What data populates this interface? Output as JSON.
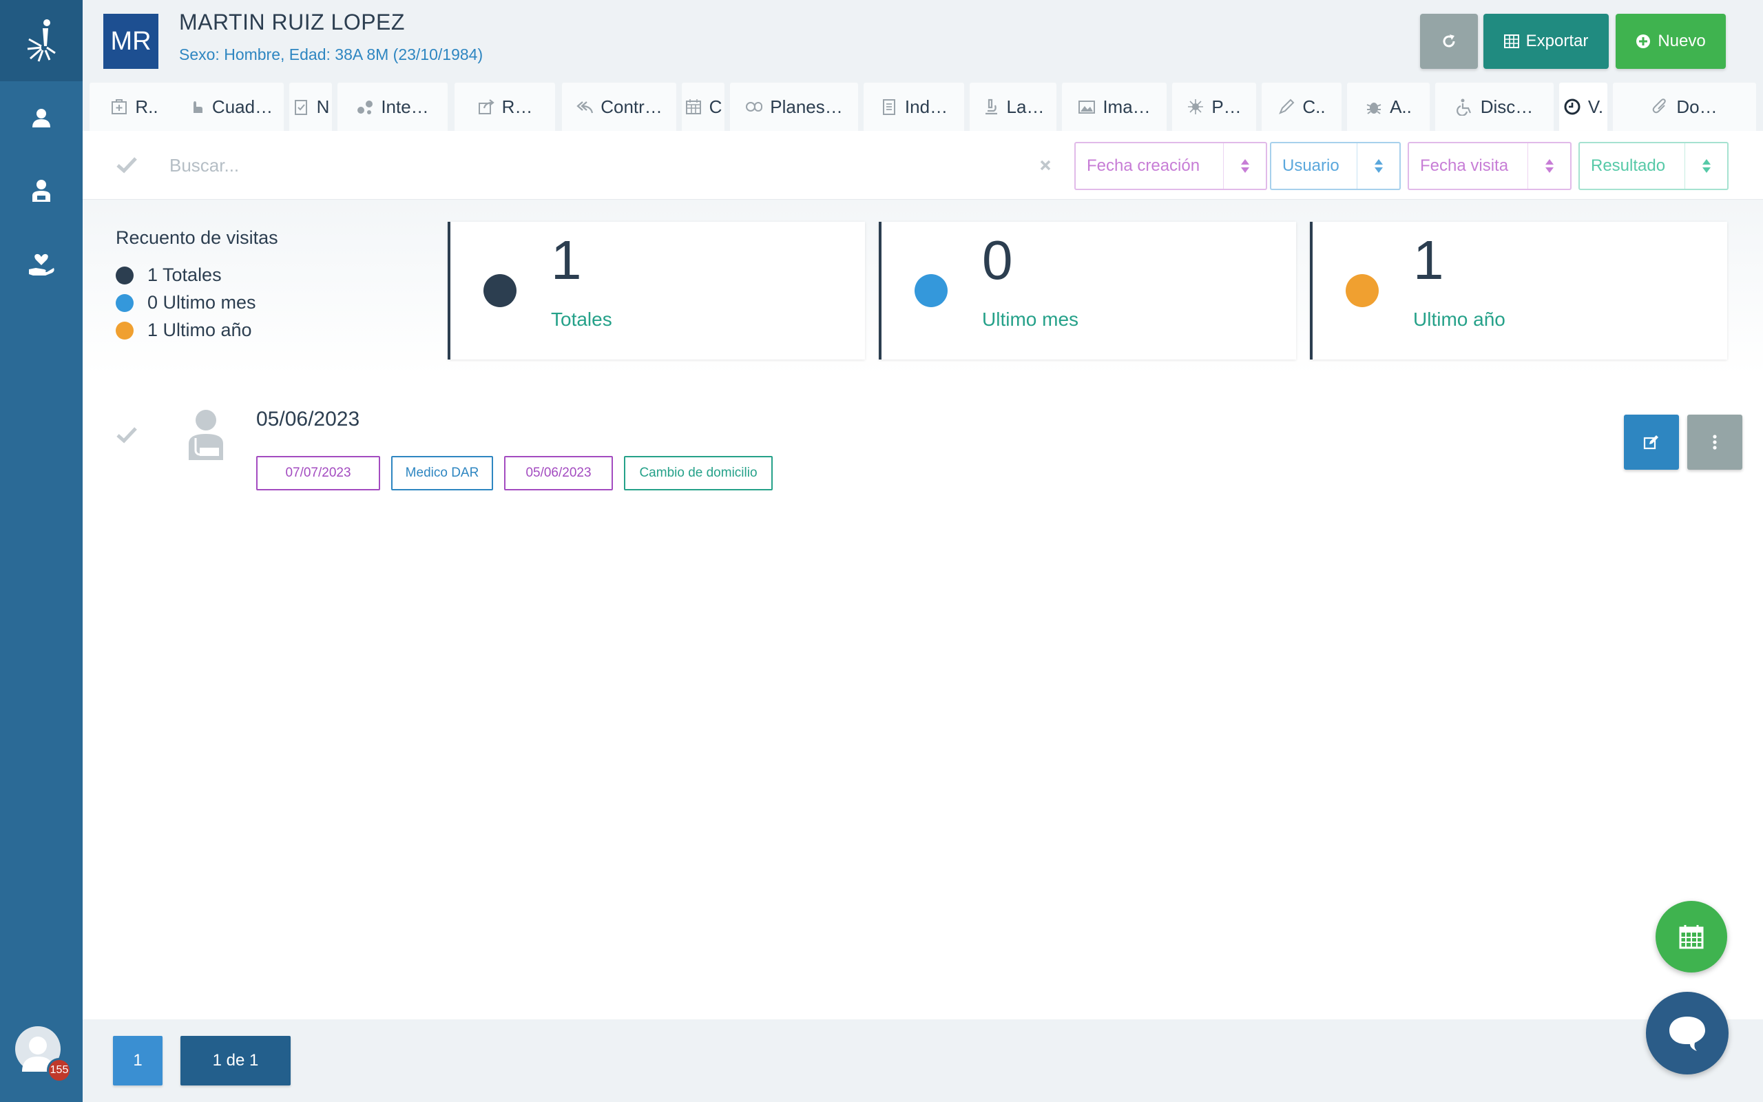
{
  "patient": {
    "initials": "MR",
    "name": "MARTIN RUIZ LOPEZ",
    "info": "Sexo: Hombre, Edad: 38A 8M (23/10/1984)"
  },
  "header_buttons": {
    "refresh_icon": "refresh-icon",
    "export_label": "Exportar",
    "new_label": "Nuevo"
  },
  "sidebar": {
    "items": [
      {
        "icon": "user-icon"
      },
      {
        "icon": "user-injured-icon"
      },
      {
        "icon": "hand-heart-icon"
      }
    ],
    "notification_count": "155"
  },
  "tabs": [
    {
      "label": "R..",
      "icon": "medkit-icon"
    },
    {
      "label": "Cuad…",
      "icon": "hand-icon"
    },
    {
      "label": "N",
      "icon": "clipboard-check-icon"
    },
    {
      "label": "Inte…",
      "icon": "molecule-icon"
    },
    {
      "label": "R…",
      "icon": "share-icon"
    },
    {
      "label": "Contr…",
      "icon": "reply-all-icon"
    },
    {
      "label": "C",
      "icon": "calendar-icon"
    },
    {
      "label": "Planes…",
      "icon": "pills-icon"
    },
    {
      "label": "Ind…",
      "icon": "clipboard-list-icon"
    },
    {
      "label": "La…",
      "icon": "microscope-icon"
    },
    {
      "label": "Ima…",
      "icon": "image-icon"
    },
    {
      "label": "P…",
      "icon": "virus-icon"
    },
    {
      "label": "C..",
      "icon": "pen-icon"
    },
    {
      "label": "A..",
      "icon": "bug-icon"
    },
    {
      "label": "Disc…",
      "icon": "wheelchair-icon"
    },
    {
      "label": "V.",
      "icon": "clock-icon",
      "active": true
    },
    {
      "label": "Do…",
      "icon": "paperclip-icon"
    }
  ],
  "filters": {
    "search_placeholder": "Buscar...",
    "selects": [
      {
        "label": "Fecha creación",
        "color": "#c77dd6"
      },
      {
        "label": "Usuario",
        "color": "#5aa7dc"
      },
      {
        "label": "Fecha visita",
        "color": "#c77dd6"
      },
      {
        "label": "Resultado",
        "color": "#56c9a7"
      }
    ]
  },
  "stats": {
    "title": "Recuento de visitas",
    "items": [
      {
        "value": "1",
        "label": "Totales",
        "legend": "1 Totales",
        "color": "#2c3e50"
      },
      {
        "value": "0",
        "label": "Ultimo mes",
        "legend": "0 Ultimo mes",
        "color": "#3498db"
      },
      {
        "value": "1",
        "label": "Ultimo año",
        "legend": "1 Ultimo año",
        "color": "#f0a030"
      }
    ]
  },
  "visits": [
    {
      "date": "05/06/2023",
      "tags": [
        {
          "text": "07/07/2023",
          "color": "#a34bc0"
        },
        {
          "text": "Medico DAR",
          "color": "#2e86c1"
        },
        {
          "text": "05/06/2023",
          "color": "#a34bc0"
        },
        {
          "text": "Cambio de domicilio",
          "color": "#25a189"
        }
      ]
    }
  ],
  "pagination": {
    "current": "1",
    "summary": "1 de 1"
  },
  "colors": {
    "sidebar": "#2b6a96",
    "primary": "#2e86c1",
    "success": "#3fb34f",
    "teal": "#208b80"
  }
}
